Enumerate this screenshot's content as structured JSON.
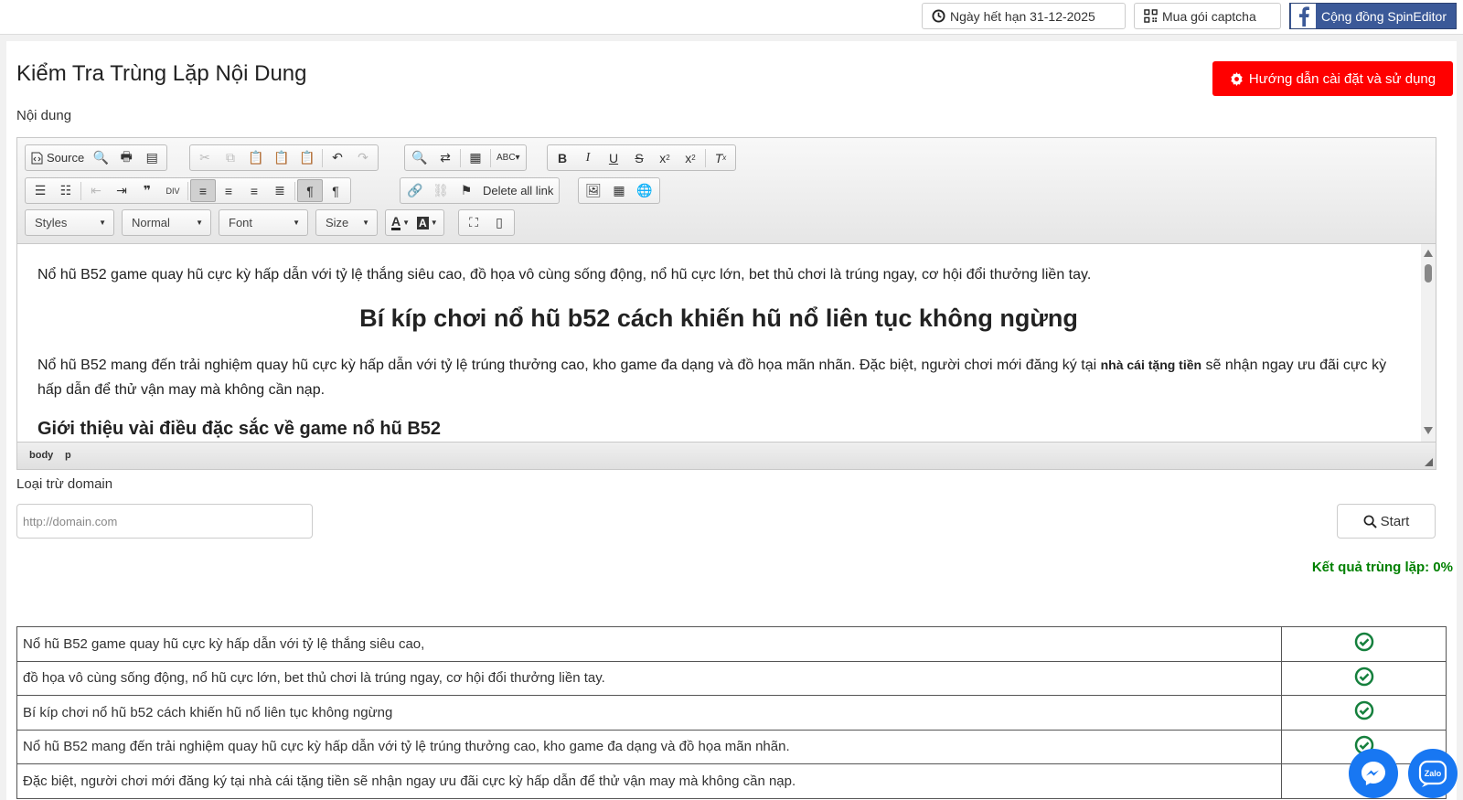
{
  "topbar": {
    "expiry": "Ngày hết hạn 31-12-2025",
    "captcha": "Mua gói captcha",
    "community": "Cộng đồng SpinEditor"
  },
  "page": {
    "title": "Kiểm Tra Trùng Lặp Nội Dung",
    "guide_button": "Hướng dẫn cài đặt và sử dụng",
    "content_label": "Nội dung",
    "exclude_label": "Loại trừ domain",
    "domain_placeholder": "http://domain.com",
    "start_button": "Start",
    "result": "Kết quả trùng lặp: 0%"
  },
  "toolbar": {
    "source": "Source",
    "delete_all_link": "Delete all link",
    "styles": "Styles",
    "format": "Normal",
    "font": "Font",
    "size": "Size",
    "accent_color": "#ff0000"
  },
  "editor": {
    "p1": "Nổ hũ B52 game quay hũ cực kỳ hấp dẫn với tỷ lệ thắng siêu cao, đồ họa vô cùng sống động, nổ hũ cực lớn, bet thủ chơi là trúng ngay, cơ hội đổi thưởng liền tay.",
    "h1": "Bí kíp chơi nổ hũ b52 cách khiến hũ nổ liên tục không ngừng",
    "p2_start": "Nổ hũ B52 mang đến trải nghiệm quay hũ cực kỳ hấp dẫn với tỷ lệ trúng thưởng cao, kho game đa dạng và đồ họa mãn nhãn. Đặc biệt, người chơi mới đăng ký tại",
    "p2_bold": "nhà cái tặng tiền",
    "p2_end": "sẽ nhận ngay ưu đãi cực kỳ hấp dẫn để thử vận may mà không cần nạp.",
    "h2": "Giới thiệu vài điều đặc sắc về game nổ hũ B52",
    "path_body": "body",
    "path_p": "p"
  },
  "results": [
    {
      "text": "Nổ hũ B52 game quay hũ cực kỳ hấp dẫn với tỷ lệ thắng siêu cao,",
      "icon": "check-circle-icon"
    },
    {
      "text": "đồ họa vô cùng sống động, nổ hũ cực lớn, bet thủ chơi là trúng ngay, cơ hội đổi thưởng liền tay.",
      "icon": "check-circle-icon"
    },
    {
      "text": "Bí kíp chơi nổ hũ b52 cách khiến hũ nổ liên tục không ngừng",
      "icon": "check-circle-icon"
    },
    {
      "text": "Nổ hũ B52 mang đến trải nghiệm quay hũ cực kỳ hấp dẫn với tỷ lệ trúng thưởng cao, kho game đa dạng và đồ họa mãn nhãn.",
      "icon": "check-circle-icon"
    },
    {
      "text": "Đặc biệt, người chơi mới đăng ký tại nhà cái tặng tiền sẽ nhận ngay ưu đãi cực kỳ hấp dẫn để thử vận may mà không cần nạp.",
      "icon": "check-circle-icon"
    }
  ]
}
